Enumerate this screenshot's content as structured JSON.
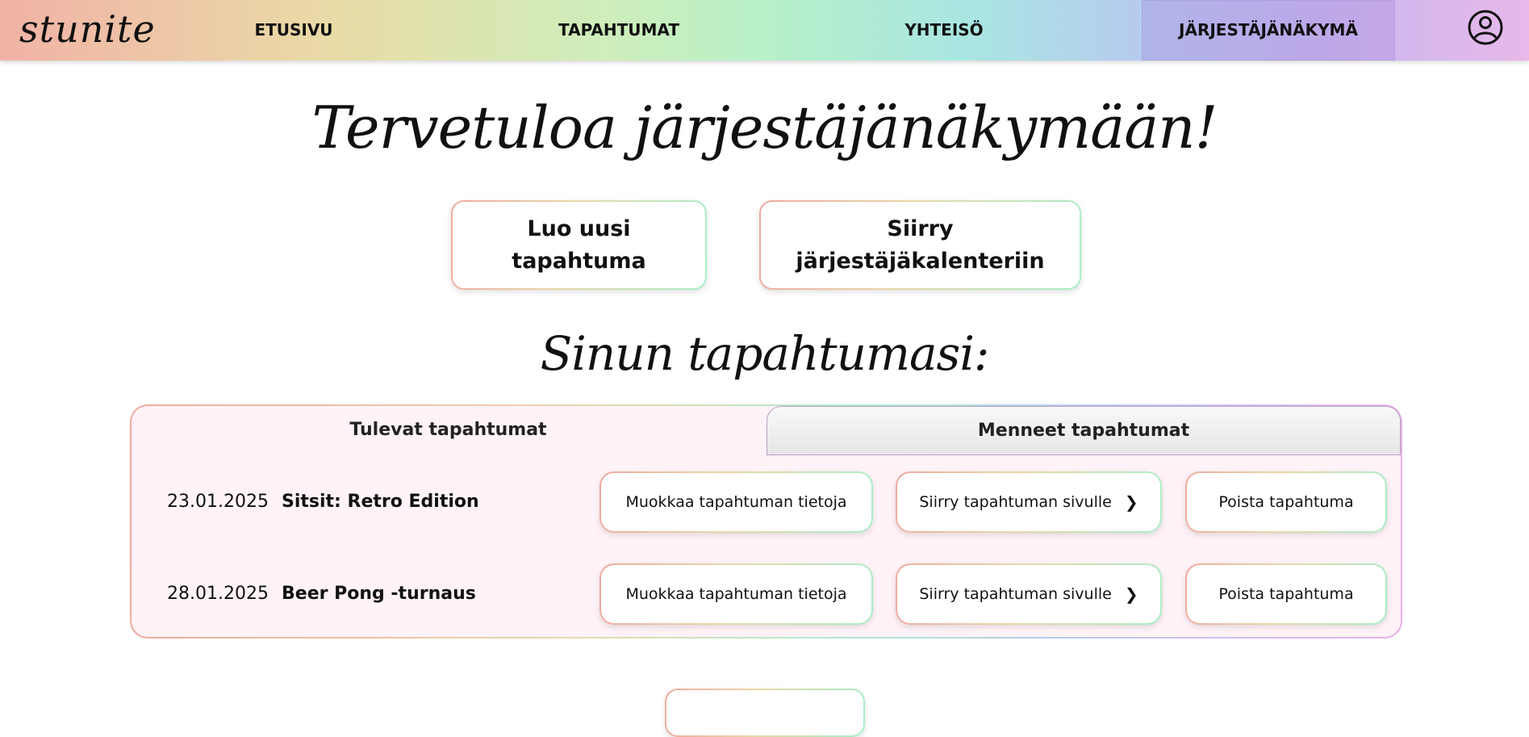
{
  "header": {
    "logo": "stunite",
    "nav": [
      {
        "label": "ETUSIVU"
      },
      {
        "label": "TAPAHTUMAT"
      },
      {
        "label": "YHTEISÖ"
      },
      {
        "label": "JÄRJESTÄJÄNÄKYMÄ",
        "active": true
      }
    ],
    "profile_icon": "user-circle-icon"
  },
  "main": {
    "welcome_title": "Tervetuloa järjestäjänäkymään!",
    "create_event_label": "Luo uusi tapahtuma",
    "calendar_label": "Siirry järjestäjäkalenteriin",
    "section_title": "Sinun tapahtumasi:",
    "tabs": [
      {
        "label": "Tulevat tapahtumat",
        "selected": true
      },
      {
        "label": "Menneet tapahtumat",
        "selected": false
      }
    ],
    "events": [
      {
        "date": "23.01.2025",
        "name": "Sitsit: Retro Edition",
        "edit_label": "Muokkaa tapahtuman tietoja",
        "goto_label": "Siirry tapahtuman sivulle",
        "delete_label": "Poista tapahtuma"
      },
      {
        "date": "28.01.2025",
        "name": "Beer Pong -turnaus",
        "edit_label": "Muokkaa tapahtuman tietoja",
        "goto_label": "Siirry tapahtuman sivulle",
        "delete_label": "Poista tapahtuma"
      }
    ]
  },
  "colors": {
    "panel_background": "#fff3f8",
    "gradient_start": "#f0aaa0",
    "gradient_mid": "#e9d8a8",
    "gradient_end": "#a8eec8",
    "active_nav": "#c6b7f0"
  }
}
